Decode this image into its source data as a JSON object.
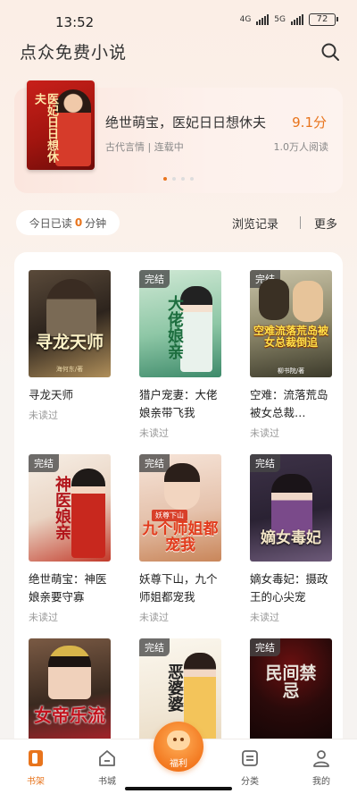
{
  "status": {
    "time": "13:52",
    "net1": "4G",
    "net2": "5G",
    "battery": "72"
  },
  "header": {
    "title": "点众免费小说",
    "search_icon": "search-icon"
  },
  "featured": {
    "title": "绝世萌宝，医妃日日想休夫",
    "score": "9.1分",
    "meta": "古代言情 | 连载中",
    "reads": "1.0万人阅读",
    "cover_text": "医妃日日想休夫"
  },
  "reading": {
    "prefix": "今日已读",
    "minutes": "0",
    "suffix": "分钟",
    "history": "浏览记录",
    "more": "更多"
  },
  "books": [
    {
      "title": "寻龙天师",
      "status": "未读过",
      "badge": "",
      "cover_text": "寻龙天师",
      "author": "海何东/著"
    },
    {
      "title": "猎户宠妻：大佬娘亲带飞我",
      "status": "未读过",
      "badge": "完结",
      "cover_text": "大佬娘亲",
      "author": ""
    },
    {
      "title": "空难：流落荒岛被女总裁…",
      "status": "未读过",
      "badge": "完结",
      "cover_text": "空难流落荒岛被女总裁倒追",
      "author": "柳书院/著"
    },
    {
      "title": "绝世萌宝：神医娘亲要守寡",
      "status": "未读过",
      "badge": "完结",
      "cover_text": "神医娘亲",
      "author": ""
    },
    {
      "title": "妖尊下山，九个师姐都宠我",
      "status": "未读过",
      "badge": "完结",
      "cover_text": "九个师姐都宠我",
      "author": "妖尊下山"
    },
    {
      "title": "嫡女毒妃：摄政王的心尖宠",
      "status": "未读过",
      "badge": "完结",
      "cover_text": "嫡女毒妃",
      "author": ""
    },
    {
      "title": "",
      "status": "",
      "badge": "",
      "cover_text": "女帝乐流",
      "author": ""
    },
    {
      "title": "",
      "status": "",
      "badge": "完结",
      "cover_text": "恶婆婆",
      "author": ""
    },
    {
      "title": "",
      "status": "",
      "badge": "完结",
      "cover_text": "民间禁忌",
      "author": ""
    }
  ],
  "tabs": [
    {
      "label": "书架",
      "icon": "bookshelf-icon"
    },
    {
      "label": "书城",
      "icon": "home-icon"
    },
    {
      "label": "福利",
      "icon": "gift-icon"
    },
    {
      "label": "分类",
      "icon": "category-icon"
    },
    {
      "label": "我的",
      "icon": "profile-icon"
    }
  ],
  "colors": {
    "accent": "#e8741c",
    "background": "#f6f3f1"
  }
}
